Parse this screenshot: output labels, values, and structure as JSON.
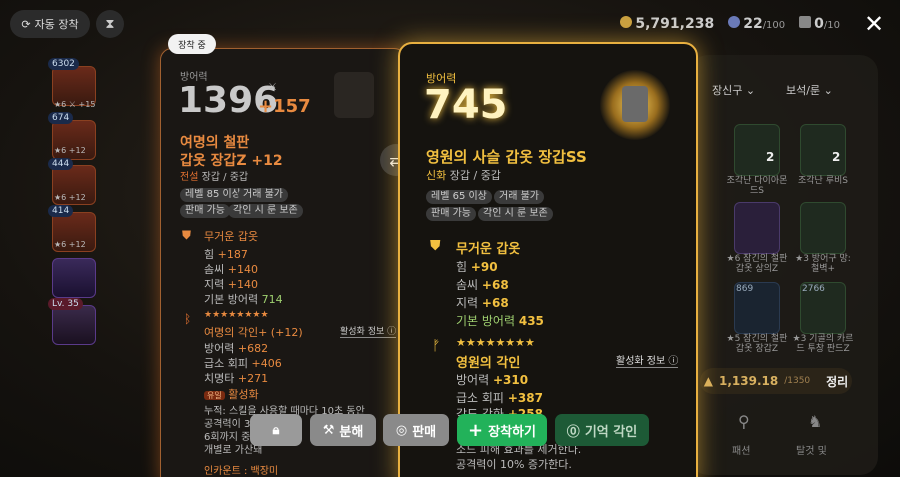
{
  "topbar": {
    "auto_equip_label": "자동 장착",
    "gold": "5,791,238",
    "gem": "22",
    "gem_max": "/100",
    "ticket": "0",
    "ticket_max": "/10"
  },
  "left_slots": [
    {
      "badge": "6302",
      "sub": "★6 ⚔ +15"
    },
    {
      "badge": "674",
      "sub": "★6 +12"
    },
    {
      "badge": "444",
      "sub": "★6 +12"
    },
    {
      "badge": "414",
      "sub": "★6 +12"
    },
    {
      "badge": "",
      "sub": ""
    },
    {
      "badge": "Lv. 35",
      "sub": ""
    }
  ],
  "right_panel": {
    "dropdown1": "장신구",
    "dropdown2": "보석/룬",
    "items": [
      {
        "count": "2",
        "label": "조각난 다이아몬드S"
      },
      {
        "count": "2",
        "label": "조각난 루비S"
      },
      {
        "count": "",
        "label": "★6 잠긴의 철판 갑옷 상의Z"
      },
      {
        "count": "",
        "label": "★3 방어구 망: 철벽+"
      },
      {
        "count": "869",
        "label": "★5 잠긴의 철판 갑옷 장갑Z"
      },
      {
        "count": "2766",
        "label": "★3 기골의 카르드 투창 판드Z"
      }
    ],
    "capacity": "1,139.18",
    "capacity_max": "/1350",
    "sort_label": "정리",
    "nav_labels": [
      "패션",
      "탈것 및"
    ]
  },
  "equipped_card": {
    "tag": "장착 중",
    "stat_label": "방어력",
    "power": "1396",
    "power_bonus": "+157",
    "name_line1": "여명의 철판",
    "name_line2": "갑옷 장갑Z +12",
    "rarity": "전설",
    "type": "장갑 / 중갑",
    "pills": [
      "레벨 85 이상",
      "거래 불가",
      "판매 가능",
      "각인 시 룬 보존"
    ],
    "set_title": "무거운 갑옷",
    "stats": [
      {
        "label": "힘",
        "value": "+187"
      },
      {
        "label": "솜씨",
        "value": "+140"
      },
      {
        "label": "지력",
        "value": "+140"
      },
      {
        "label": "기본 방어력",
        "value": "714"
      }
    ],
    "engrave_stars": "★★★★★★★★",
    "engrave_title": "여명의 각인+ (+12)",
    "activation_info": "활성화 정보",
    "engrave_stats": [
      {
        "label": "방어력",
        "value": "+682"
      },
      {
        "label": "급소 회피",
        "value": "+406"
      },
      {
        "label": "치명타",
        "value": "+271"
      }
    ],
    "effect_tag": "유일",
    "effect_label": "활성화",
    "effect_lines": [
      "누적: 스킬을 사용할 때마다 10초 동안",
      "공격력이 3",
      "6회까지 중",
      "개별로 가산돼"
    ],
    "bottom_label": "인카운트 : 백장미"
  },
  "new_card": {
    "stat_label": "방어력",
    "power": "745",
    "name": "영원의 사슬 갑옷 장갑SS",
    "rarity": "신화",
    "type": "장갑 / 중갑",
    "pills": [
      "레벨 65 이상",
      "거래 불가",
      "판매 가능",
      "각인 시 룬 보존"
    ],
    "set_title": "무거운 갑옷",
    "stats": [
      {
        "label": "힘",
        "value": "+90"
      },
      {
        "label": "솜씨",
        "value": "+68"
      },
      {
        "label": "지력",
        "value": "+68"
      },
      {
        "label": "기본 방어력",
        "value": "435"
      }
    ],
    "engrave_stars": "★★★★★★★★",
    "engrave_title": "영원의 각인",
    "activation_info": "활성화 정보",
    "engrave_stats": [
      {
        "label": "방어력",
        "value": "+310"
      },
      {
        "label": "급소 회피",
        "value": "+387"
      },
      {
        "label": "각도 강화",
        "value": "+258"
      }
    ],
    "bottom_lines": [
      "소드 피해 효과를 제거한다.",
      "공격력이 10% 증가한다."
    ]
  },
  "actions": {
    "lock": "",
    "disassemble": "분해",
    "sell": "판매",
    "equip": "장착하기",
    "memory_engrave": "기억 각인"
  },
  "colors": {
    "accent": "#e8b040",
    "equip_green": "#22b25a",
    "legend": "#e07030",
    "mythic": "#f2c040"
  }
}
